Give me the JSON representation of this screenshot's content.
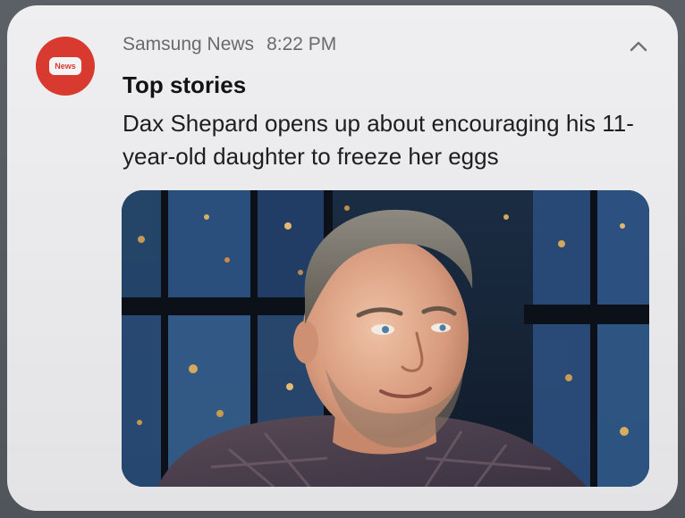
{
  "notification": {
    "app_name": "Samsung News",
    "time": "8:22 PM",
    "app_icon": {
      "name": "samsung-news-icon",
      "badge_text": "News",
      "color": "#d83a30"
    },
    "collapse_icon": "chevron-up-icon",
    "title": "Top stories",
    "message": "Dax Shepard opens up about encouraging his 11-year-old daughter to freeze her eggs",
    "image": {
      "description": "photo of smiling man with stubble in front of night city windows"
    }
  }
}
